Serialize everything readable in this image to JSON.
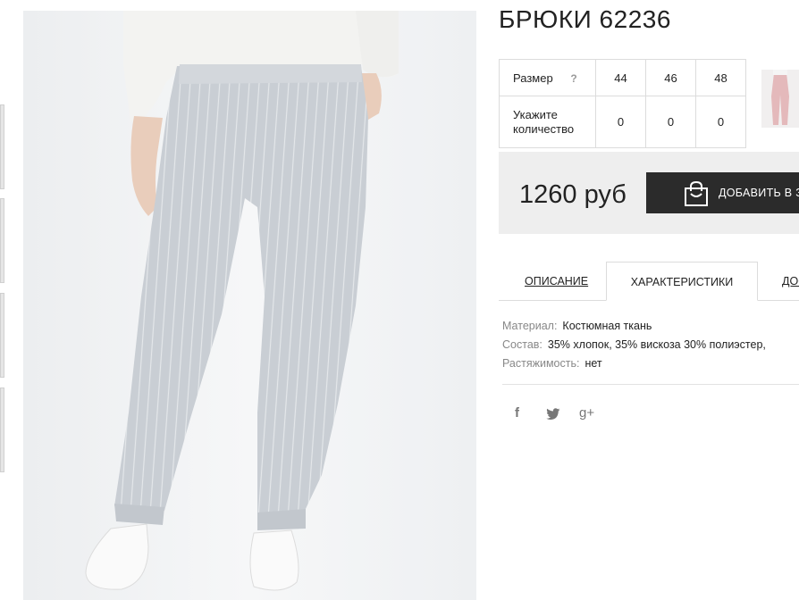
{
  "product": {
    "title": "БРЮКИ 62236"
  },
  "sizes_table": {
    "size_label": "Размер",
    "help_mark": "?",
    "sizes": [
      "44",
      "46",
      "48"
    ],
    "qty_label": "Укажите количество",
    "quantities": [
      "0",
      "0",
      "0"
    ]
  },
  "buy": {
    "price": "1260 руб",
    "add_to_cart": "ДОБАВИТЬ В З"
  },
  "tabs": {
    "description": "ОПИСАНИЕ",
    "specs": "ХАРАКТЕРИСТИКИ",
    "more": "ДОС"
  },
  "specs": [
    {
      "key": "Материал:",
      "value": "Костюмная ткань"
    },
    {
      "key": "Состав:",
      "value": "35% хлопок, 35% вискоза 30% полиэстер,"
    },
    {
      "key": "Растяжимость:",
      "value": "нет"
    }
  ],
  "social": {
    "facebook": "f",
    "twitter": "twitter-icon",
    "google": "g+"
  }
}
